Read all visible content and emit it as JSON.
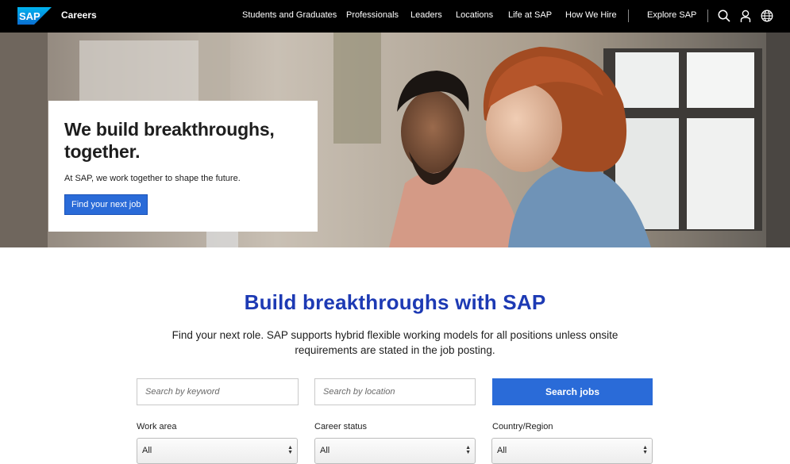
{
  "header": {
    "logo_text": "SAP",
    "brand": "Careers",
    "nav": [
      "Students and Graduates",
      "Professionals",
      "Leaders",
      "Locations",
      "Life at SAP",
      "How We Hire"
    ],
    "explore": "Explore SAP",
    "icons": [
      "search-icon",
      "user-icon",
      "globe-icon"
    ]
  },
  "hero": {
    "title": "We build breakthroughs, together.",
    "subtitle": "At SAP, we work together to shape the future.",
    "cta": "Find your next job"
  },
  "search_section": {
    "title": "Build breakthroughs with SAP",
    "description": "Find your next role. SAP supports hybrid flexible working models for all positions unless onsite requirements are stated in the job posting.",
    "keyword_placeholder": "Search by keyword",
    "location_placeholder": "Search by location",
    "search_button": "Search jobs",
    "filters": [
      {
        "label": "Work area",
        "value": "All"
      },
      {
        "label": "Career status",
        "value": "All"
      },
      {
        "label": "Country/Region",
        "value": "All"
      }
    ]
  },
  "colors": {
    "accent": "#2a6bd8",
    "title_blue": "#1d3ab4",
    "topbar": "#000000"
  }
}
